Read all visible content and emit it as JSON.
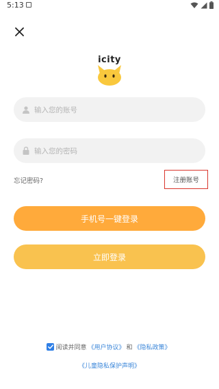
{
  "status_bar": {
    "time": "5:13"
  },
  "app": {
    "logo_text": "icity",
    "brand_colors": {
      "primary_button": "#ffaa3b",
      "secondary_button": "#f9c24f",
      "logo_yellow": "#f9c83d",
      "link_blue": "#3a86d9",
      "highlight_red": "#d9342b"
    }
  },
  "form": {
    "account_placeholder": "输入您的账号",
    "password_placeholder": "输入您的密码",
    "forgot_password": "忘记密码?",
    "register": "注册账号"
  },
  "buttons": {
    "phone_login": "手机号一键登录",
    "login": "立即登录"
  },
  "agreement": {
    "checked": true,
    "prefix": "阅读并同意",
    "user_agreement": "《用户协议》",
    "and": "和",
    "privacy_policy": "《隐私政策》",
    "children_privacy": "《儿童隐私保护声明》"
  },
  "icons": {
    "close": "close-icon",
    "user": "user-icon",
    "lock": "lock-icon",
    "wifi": "wifi-icon",
    "signal": "signal-icon",
    "battery": "battery-icon",
    "check": "check-icon"
  }
}
